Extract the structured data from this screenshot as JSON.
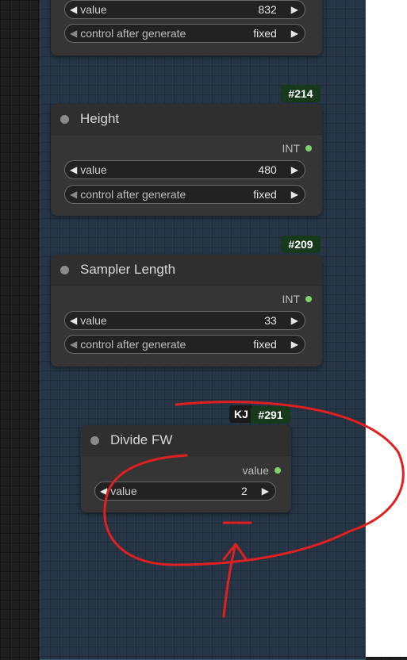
{
  "nodes": {
    "top": {
      "widgets": [
        {
          "label": "value",
          "value": "832"
        },
        {
          "label": "control after generate",
          "value": "fixed"
        }
      ]
    },
    "height": {
      "badge": "#214",
      "title": "Height",
      "output": "INT",
      "widgets": [
        {
          "label": "value",
          "value": "480"
        },
        {
          "label": "control after generate",
          "value": "fixed"
        }
      ]
    },
    "sampler_length": {
      "badge": "#209",
      "title": "Sampler Length",
      "output": "INT",
      "widgets": [
        {
          "label": "value",
          "value": "33"
        },
        {
          "label": "control after generate",
          "value": "fixed"
        }
      ]
    },
    "divide_fw": {
      "badge_kj": "KJ",
      "badge": "#291",
      "title": "Divide FW",
      "output": "value",
      "widgets": [
        {
          "label": "value",
          "value": "2"
        }
      ]
    }
  },
  "colors": {
    "group_bg": "#263646",
    "node_bg": "#353535",
    "id_badge_bg": "#173a1c",
    "output_dot": "#7ed46a",
    "annotation": "#e02020"
  },
  "icons": {
    "decrement": "left-triangle-icon",
    "increment": "right-triangle-icon"
  }
}
